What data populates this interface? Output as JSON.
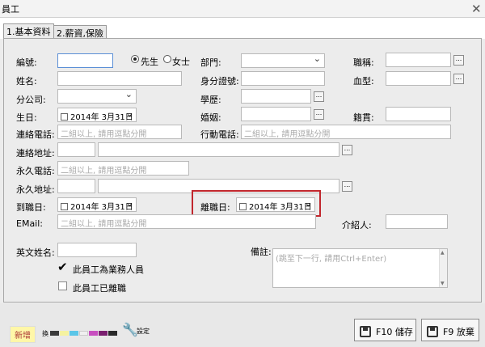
{
  "window": {
    "title": "員工",
    "close_glyph": "✕"
  },
  "tabs": [
    {
      "label": "1.基本資料"
    },
    {
      "label": "2.薪資,保險"
    }
  ],
  "form": {
    "emp_no_label": "編號:",
    "gender_male": "先生",
    "gender_female": "女士",
    "dept_label": "部門:",
    "title_label": "職稱:",
    "name_label": "姓名:",
    "id_label": "身分證號:",
    "blood_label": "血型:",
    "branch_label": "分公司:",
    "edu_label": "學歷:",
    "birth_label": "生日:",
    "birth_value": "2014年  3月31日",
    "marriage_label": "婚姻:",
    "native_label": "籍貫:",
    "phone_label": "連絡電話:",
    "phone_placeholder": "二組以上, 請用逗點分開",
    "mobile_label": "行動電話:",
    "mobile_placeholder": "二組以上, 請用逗點分開",
    "addr_label": "連絡地址:",
    "perm_phone_label": "永久電話:",
    "perm_phone_placeholder": "二組以上, 請用逗點分開",
    "perm_addr_label": "永久地址:",
    "hire_label": "到職日:",
    "hire_value": "2014年  3月31日",
    "leave_label": "離職日:",
    "leave_value": "2014年  3月31日",
    "email_label": "EMail:",
    "email_placeholder": "二組以上, 請用逗點分開",
    "referrer_label": "介紹人:",
    "english_label": "英文姓名:",
    "note_label": "備註:",
    "note_placeholder": "(跳至下一行, 請用Ctrl+Enter)",
    "sales_check_label": "此員工為業務人員",
    "resigned_check_label": "此員工已離職",
    "dots": "..."
  },
  "bottom": {
    "new_badge": "新增",
    "color_label": "換",
    "settings_label": "設定",
    "save_button": "F10 儲存",
    "cancel_button": "F9 放棄"
  },
  "colors": {
    "highlight": "#c1272d",
    "swatches": [
      "#3b3b3b",
      "#f5f2a0",
      "#5bc6e8",
      "#f0f0f0",
      "#c84fc0",
      "#7a1f6f",
      "#2a2a2a"
    ]
  }
}
